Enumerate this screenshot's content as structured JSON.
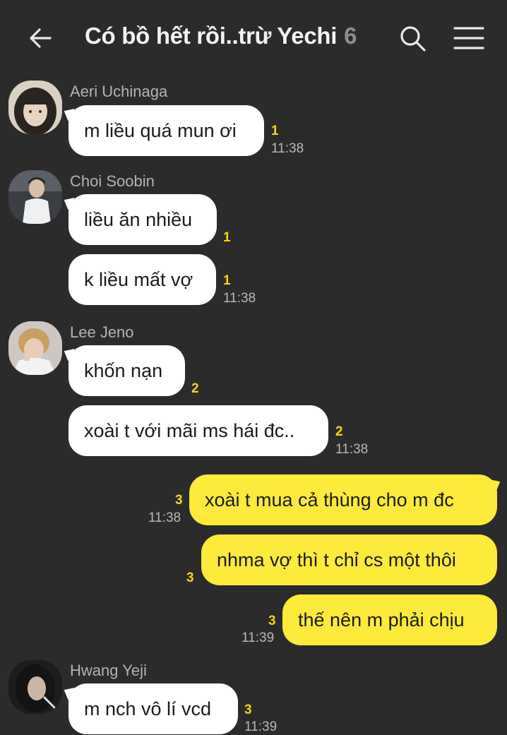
{
  "header": {
    "title": "Có bồ hết rồi..trừ Yechi",
    "member_count": "6"
  },
  "colors": {
    "background": "#2b2b2b",
    "incoming_bubble": "#ffffff",
    "outgoing_bubble": "#fdea3a",
    "unread_count": "#f6d516"
  },
  "messages": [
    {
      "sender": "Aeri Uchinaga",
      "text": "m liều quá mun ơi",
      "unread": "1",
      "time": "11:38"
    },
    {
      "sender": "Choi Soobin",
      "text": "liều ăn nhiều",
      "unread": "1"
    },
    {
      "text": "k liều mất vợ",
      "unread": "1",
      "time": "11:38"
    },
    {
      "sender": "Lee Jeno",
      "text": "khốn nạn",
      "unread": "2"
    },
    {
      "text": "xoài t với mãi ms hái đc..",
      "unread": "2",
      "time": "11:38"
    },
    {
      "text": "xoài t mua cả thùng cho m đc",
      "unread": "3",
      "time": "11:38"
    },
    {
      "text": "nhma vợ thì t chỉ cs một thôi",
      "unread": "3"
    },
    {
      "text": "thế nên m phải chịu",
      "unread": "3",
      "time": "11:39"
    },
    {
      "sender": "Hwang Yeji",
      "text": "m nch vô lí vcd",
      "unread": "3",
      "time": "11:39"
    }
  ]
}
